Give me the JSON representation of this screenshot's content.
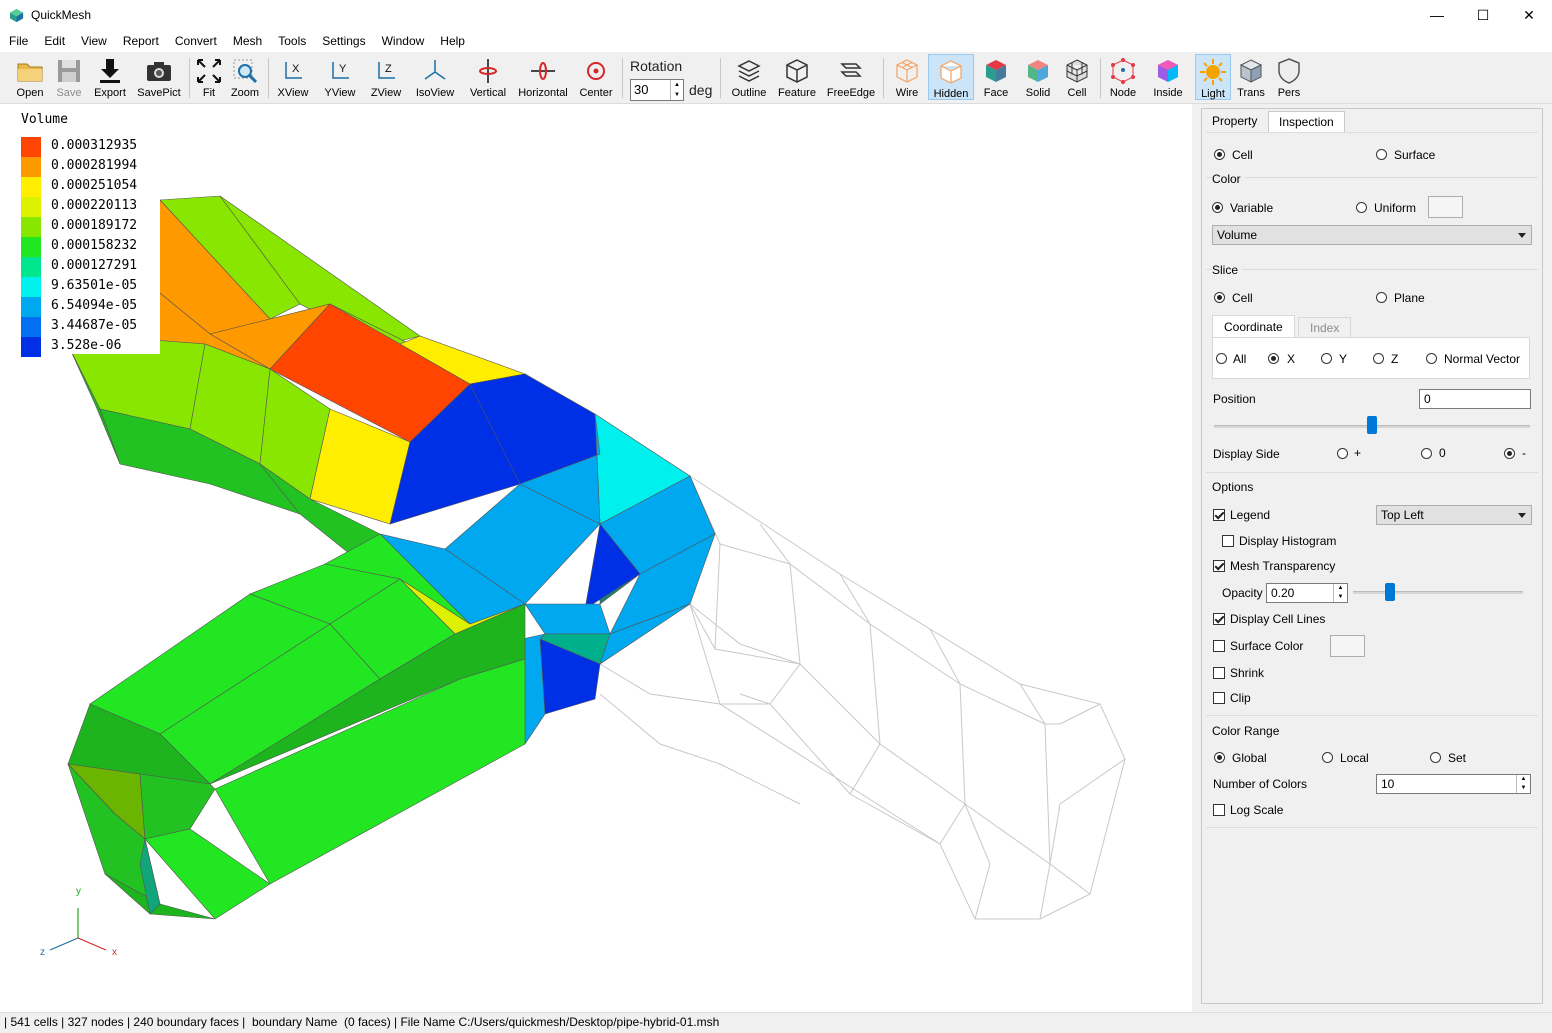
{
  "window": {
    "title": "QuickMesh",
    "minimize": "—",
    "maximize": "☐",
    "close": "✕"
  },
  "menu": [
    "File",
    "Edit",
    "View",
    "Report",
    "Convert",
    "Mesh",
    "Tools",
    "Settings",
    "Window",
    "Help"
  ],
  "toolbar": {
    "open": "Open",
    "save": "Save",
    "export": "Export",
    "savepict": "SavePict",
    "fit": "Fit",
    "zoom": "Zoom",
    "xview": "XView",
    "yview": "YView",
    "zview": "ZView",
    "isoview": "IsoView",
    "vertical": "Vertical",
    "horizontal": "Horizontal",
    "center": "Center",
    "rotation_label": "Rotation",
    "rotation_value": "30",
    "rotation_unit": "deg",
    "outline": "Outline",
    "feature": "Feature",
    "freeedge": "FreeEdge",
    "wire": "Wire",
    "hidden": "Hidden",
    "face": "Face",
    "solid": "Solid",
    "cell": "Cell",
    "node": "Node",
    "inside": "Inside",
    "light": "Light",
    "trans": "Trans",
    "pers": "Pers"
  },
  "legend": {
    "title": "Volume",
    "entries": [
      {
        "label": "0.000312935",
        "color": "#ff4500"
      },
      {
        "label": "0.000281994",
        "color": "#ff9900"
      },
      {
        "label": "0.000251054",
        "color": "#ffee00"
      },
      {
        "label": "0.000220113",
        "color": "#ddf000"
      },
      {
        "label": "0.000189172",
        "color": "#88e600"
      },
      {
        "label": "0.000158232",
        "color": "#22e622"
      },
      {
        "label": "0.000127291",
        "color": "#00e68c"
      },
      {
        "label": "9.63501e-05",
        "color": "#00f0ee"
      },
      {
        "label": "6.54094e-05",
        "color": "#00a8f0"
      },
      {
        "label": "3.44687e-05",
        "color": "#0070f0"
      },
      {
        "label": "3.528e-06",
        "color": "#0030e6"
      }
    ]
  },
  "axes": {
    "y": "y",
    "x": "x",
    "z": "z"
  },
  "panel": {
    "tabs": [
      "Property",
      "Inspection"
    ],
    "mode": {
      "cell": "Cell",
      "surface": "Surface"
    },
    "color": {
      "title": "Color",
      "variable": "Variable",
      "uniform": "Uniform",
      "selected": "Volume"
    },
    "slice": {
      "title": "Slice",
      "cell": "Cell",
      "plane": "Plane",
      "tabs": [
        "Coordinate",
        "Index"
      ],
      "axes": [
        "All",
        "X",
        "Y",
        "Z",
        "Normal Vector"
      ],
      "position_label": "Position",
      "position_value": "0",
      "display_side_label": "Display Side",
      "sides": [
        "+",
        "0",
        "-"
      ]
    },
    "options": {
      "title": "Options",
      "legend": "Legend",
      "legend_pos": "Top Left",
      "histogram": "Display Histogram",
      "transparency": "Mesh Transparency",
      "opacity_label": "Opacity",
      "opacity_value": "0.20",
      "cell_lines": "Display Cell Lines",
      "surface_color": "Surface Color",
      "shrink": "Shrink",
      "clip": "Clip"
    },
    "color_range": {
      "title": "Color Range",
      "global": "Global",
      "local": "Local",
      "set": "Set",
      "num_colors_label": "Number of Colors",
      "num_colors_value": "10",
      "log_scale": "Log Scale"
    }
  },
  "status": "| 541 cells | 327 nodes | 240 boundary faces |  boundary Name  (0 faces) | File Name C:/Users/quickmesh/Desktop/pipe-hybrid-01.msh"
}
